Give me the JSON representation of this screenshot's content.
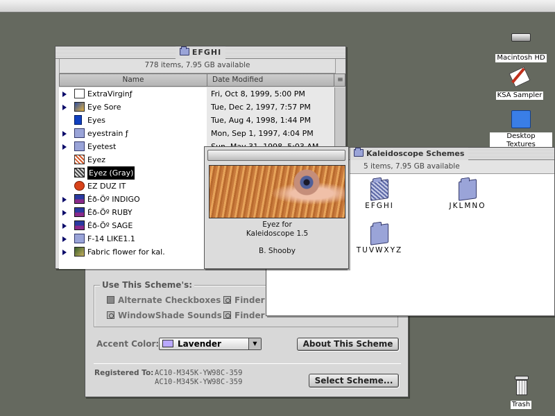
{
  "desktop": {
    "icons": [
      {
        "label": "Macintosh HD",
        "icon": "hard-drive-icon"
      },
      {
        "label": "KSA Sampler",
        "icon": "sampler-icon"
      },
      {
        "label": "Desktop Textures",
        "icon": "folder-icon"
      },
      {
        "label": "Trash",
        "icon": "trash-icon"
      }
    ]
  },
  "control_panel": {
    "use_scheme_label": "Use This Scheme's:",
    "options": {
      "alternate_checkboxes": "Alternate Checkboxes",
      "windowshade_sounds": "WindowShade Sounds",
      "finder1": "Finder",
      "finder2": "Finder"
    },
    "accent_color_label": "Accent Color:",
    "accent_color_value": "Lavender",
    "accent_swatch": "#b9a8ff",
    "about_button": "About This Scheme",
    "registered_label": "Registered To:",
    "registered_line1": "AC10-M345K-YW98C-359",
    "registered_line2": "AC10-M345K-YW98C-359",
    "select_button": "Select Scheme..."
  },
  "efghi_window": {
    "title": "EFGHI",
    "info": "778 items, 7.95 GB available",
    "columns": {
      "name": "Name",
      "date": "Date Modified"
    },
    "rows": [
      {
        "name": "ExtraVirginƒ",
        "date": "Fri, Oct 8, 1999, 5:00 PM",
        "icon": "folder-outline-icon",
        "expandable": true
      },
      {
        "name": "Eye Sore",
        "date": "Tue, Dec 2, 1997, 7:57 PM",
        "icon": "app-icon",
        "expandable": true
      },
      {
        "name": "Eyes",
        "date": "Tue, Aug 4, 1998, 1:44 PM",
        "icon": "document-icon",
        "expandable": false
      },
      {
        "name": "eyestrain ƒ",
        "date": "Mon, Sep 1, 1997, 4:04 PM",
        "icon": "folder-icon",
        "expandable": true
      },
      {
        "name": "Eyetest",
        "date": "Sun, May 31, 1998, 5:03 AM",
        "icon": "folder-icon",
        "expandable": true
      },
      {
        "name": "Eyez",
        "date": "",
        "icon": "scheme-icon",
        "expandable": false
      },
      {
        "name": "Eyez (Gray)",
        "date": "",
        "icon": "scheme-gray-icon",
        "expandable": false
      },
      {
        "name": "EZ DUZ IT",
        "date": "",
        "icon": "apple-icon",
        "expandable": false
      },
      {
        "name": "Éð-Öº INDIGO",
        "date": "",
        "icon": "monitor-icon",
        "expandable": true
      },
      {
        "name": "Éð-Öº RUBY",
        "date": "",
        "icon": "monitor-icon",
        "expandable": true
      },
      {
        "name": "Éð-Öº SAGE",
        "date": "",
        "icon": "monitor-icon",
        "expandable": true
      },
      {
        "name": "F-14 LIKE1.1",
        "date": "",
        "icon": "folder-icon",
        "expandable": true
      },
      {
        "name": "Fabric flower for kal.",
        "date": "",
        "icon": "image-icon",
        "expandable": true
      }
    ]
  },
  "about_window": {
    "line1": "Eyez for",
    "line2": "Kaleidoscope 1.5",
    "author": "B. Shooby"
  },
  "schemes_window": {
    "title": "Kaleidoscope Schemes",
    "info": "5 items, 7.95 GB available",
    "folders": [
      "EFGHI",
      "JKLMNO",
      "TUVWXYZ"
    ]
  }
}
